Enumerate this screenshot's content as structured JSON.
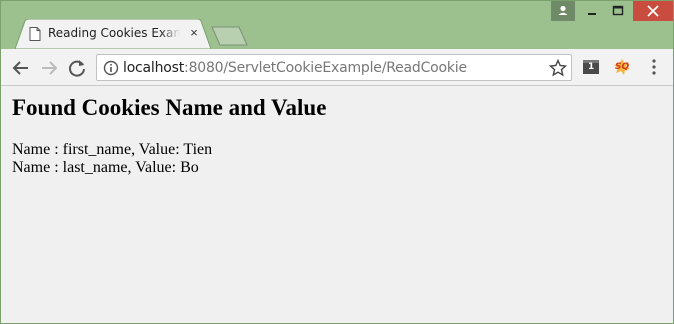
{
  "tab": {
    "title": "Reading Cookies Example",
    "close_glyph": "×"
  },
  "address_bar": {
    "host": "localhost",
    "path": ":8080/ServletCookieExample/ReadCookie"
  },
  "extensions": {
    "first_badge": "1",
    "second_label": "SQ"
  },
  "page": {
    "heading": "Found Cookies Name and Value",
    "cookies": [
      "Name : first_name, Value: Tien",
      "Name : last_name, Value: Bo"
    ]
  },
  "colors": {
    "frame": "#9cc18f",
    "toolbar": "#f2f2f2",
    "content_bg": "#f0f0f0",
    "close_button": "#c84d3f"
  }
}
